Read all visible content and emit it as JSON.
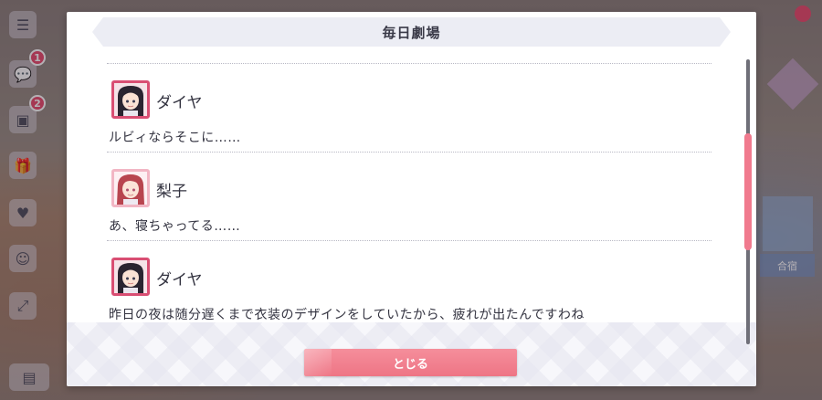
{
  "dialog": {
    "title": "毎日劇場",
    "close_label": "とじる"
  },
  "entries": [
    {
      "speaker": "ダイヤ",
      "avatar": "dia-avatar",
      "line": "ルビィならそこに……"
    },
    {
      "speaker": "梨子",
      "avatar": "riko-avatar",
      "line": "あ、寝ちゃってる……"
    },
    {
      "speaker": "ダイヤ",
      "avatar": "dia-avatar",
      "line": "昨日の夜は随分遅くまで衣装のデザインをしていたから、疲れが出たんですわね"
    }
  ],
  "background": {
    "badges": [
      "1",
      "2"
    ],
    "right_label": "合宿"
  },
  "colors": {
    "accent": "#ee7585",
    "dia_frame": "#d94e73",
    "riko_frame": "#f2b6c4",
    "scroll_thumb": "#f07a8e"
  }
}
